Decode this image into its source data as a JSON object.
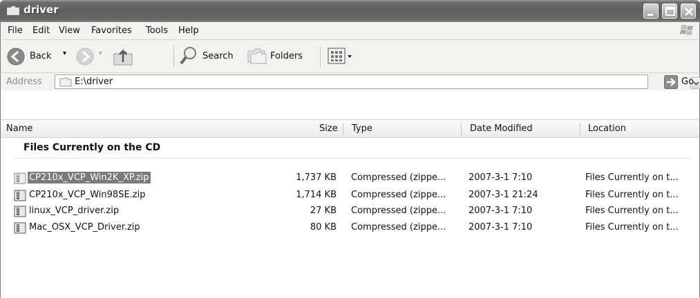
{
  "window": {
    "title": "driver"
  },
  "menu": [
    "File",
    "Edit",
    "View",
    "Favorites",
    "Tools",
    "Help"
  ],
  "toolbar": {
    "back": "Back",
    "search": "Search",
    "folders": "Folders"
  },
  "address": {
    "label": "Address",
    "path": "E:\\driver",
    "go": "Go"
  },
  "columns": {
    "name": "Name",
    "size": "Size",
    "type": "Type",
    "date": "Date Modified",
    "location": "Location"
  },
  "group": {
    "title": "Files Currently on the CD"
  },
  "files": [
    {
      "name": "CP210x_VCP_Win2K_XP.zip",
      "size": "1,737 KB",
      "type": "Compressed (zippe...",
      "date": "2007-3-1 7:10",
      "location": "Files Currently on t...",
      "selected": true
    },
    {
      "name": "CP210x_VCP_Win98SE.zip",
      "size": "1,714 KB",
      "type": "Compressed (zippe...",
      "date": "2007-3-1 21:24",
      "location": "Files Currently on t...",
      "selected": false
    },
    {
      "name": "linux_VCP_driver.zip",
      "size": "27 KB",
      "type": "Compressed (zippe...",
      "date": "2007-3-1 7:10",
      "location": "Files Currently on t...",
      "selected": false
    },
    {
      "name": "Mac_OSX_VCP_Driver.zip",
      "size": "80 KB",
      "type": "Compressed (zippe...",
      "date": "2007-3-1 7:10",
      "location": "Files Currently on t...",
      "selected": false
    }
  ],
  "icons": {
    "title": "folder-icon",
    "back": "back-arrow-icon",
    "forward": "forward-arrow-icon",
    "up": "up-folder-icon",
    "search": "search-icon",
    "folders": "folders-icon",
    "views": "views-icon",
    "go": "go-arrow-icon",
    "file": "zip-file-icon"
  },
  "colors": {
    "titlebar": "#6e6e6e",
    "selection": "#7a7a7a",
    "chrome": "#f3f2ee"
  }
}
